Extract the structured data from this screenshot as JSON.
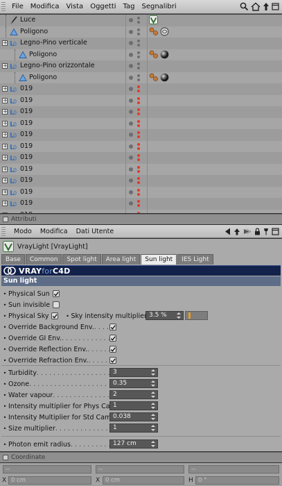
{
  "menu": {
    "items": [
      "File",
      "Modifica",
      "Vista",
      "Oggetti",
      "Tag",
      "Segnalibri"
    ]
  },
  "objects": [
    {
      "name": "Luce",
      "kind": "light",
      "indent": 0,
      "expandable": false,
      "tags": [
        "vray-light-tag"
      ],
      "dot_red": false
    },
    {
      "name": "Poligono",
      "kind": "polygon",
      "indent": 0,
      "expandable": false,
      "tags": [
        "material-tag",
        "texture-tag"
      ],
      "dot_red": false
    },
    {
      "name": "Legno-Pino verticale",
      "kind": "null",
      "indent": 0,
      "expandable": true,
      "tags": [],
      "dot_red": false
    },
    {
      "name": "Poligono",
      "kind": "polygon",
      "indent": 1,
      "expandable": false,
      "tags": [
        "material-tag",
        "sphere-material"
      ],
      "dot_red": false
    },
    {
      "name": "Legno-Pino orizzontale",
      "kind": "null",
      "indent": 0,
      "expandable": true,
      "tags": [],
      "dot_red": false
    },
    {
      "name": "Poligono",
      "kind": "polygon",
      "indent": 1,
      "expandable": false,
      "tags": [
        "material-tag",
        "sphere-material"
      ],
      "dot_red": false
    },
    {
      "name": "019",
      "kind": "null",
      "indent": 0,
      "expandable": true,
      "tags": [],
      "dot_red": true
    },
    {
      "name": "019",
      "kind": "null",
      "indent": 0,
      "expandable": true,
      "tags": [],
      "dot_red": true
    },
    {
      "name": "019",
      "kind": "null",
      "indent": 0,
      "expandable": true,
      "tags": [],
      "dot_red": true
    },
    {
      "name": "019",
      "kind": "null",
      "indent": 0,
      "expandable": true,
      "tags": [],
      "dot_red": true
    },
    {
      "name": "019",
      "kind": "null",
      "indent": 0,
      "expandable": true,
      "tags": [],
      "dot_red": true
    },
    {
      "name": "019",
      "kind": "null",
      "indent": 0,
      "expandable": true,
      "tags": [],
      "dot_red": true
    },
    {
      "name": "019",
      "kind": "null",
      "indent": 0,
      "expandable": true,
      "tags": [],
      "dot_red": true
    },
    {
      "name": "019",
      "kind": "null",
      "indent": 0,
      "expandable": true,
      "tags": [],
      "dot_red": true
    },
    {
      "name": "019",
      "kind": "null",
      "indent": 0,
      "expandable": true,
      "tags": [],
      "dot_red": true
    },
    {
      "name": "019",
      "kind": "null",
      "indent": 0,
      "expandable": true,
      "tags": [],
      "dot_red": true
    },
    {
      "name": "019",
      "kind": "null",
      "indent": 0,
      "expandable": true,
      "tags": [],
      "dot_red": true
    },
    {
      "name": "019",
      "kind": "null",
      "indent": 0,
      "expandable": true,
      "tags": [],
      "dot_red": true
    }
  ],
  "attributes": {
    "panel_title": "Attributi",
    "menu": [
      "Modo",
      "Modifica",
      "Dati Utente"
    ],
    "object_title": "VrayLight [VrayLight]",
    "tabs": [
      {
        "label": "Base",
        "active": false
      },
      {
        "label": "Common",
        "active": false
      },
      {
        "label": "Spot light",
        "active": false
      },
      {
        "label": "Area light",
        "active": false
      },
      {
        "label": "Sun light",
        "active": true
      },
      {
        "label": "IES Light",
        "active": false
      }
    ],
    "banner": {
      "v": "VRAY",
      "for": "for",
      "c4d": "C4D"
    },
    "section": "Sun light",
    "physical_sun": {
      "label": "Physical Sun",
      "checked": true
    },
    "sun_invisible": {
      "label": "Sun invisible",
      "checked": false
    },
    "physical_sky": {
      "label": "Physical Sky",
      "checked": true
    },
    "sky_intensity": {
      "label": "Sky intensity multiplier",
      "value": "3.5 %",
      "fraction": 0.035
    },
    "overrides": [
      {
        "label": "Override Background Env.",
        "leader": " . . . . . .",
        "checked": true
      },
      {
        "label": "Override GI Env.",
        "leader": " . . . . . . . . . . . . .",
        "checked": true
      },
      {
        "label": "Override Reflection Env.",
        "leader": " . . . . . . .",
        "checked": true
      },
      {
        "label": "Override Refraction Env.",
        "leader": " . . . . . . .",
        "checked": true
      }
    ],
    "params": [
      {
        "label": "Turbidity",
        "leader": " . . . . . . . . . . . . . . . . . . . . . . . .",
        "value": "3"
      },
      {
        "label": "Ozone",
        "leader": " . . . . . . . . . . . . . . . . . . . . . . . . . . .",
        "value": "0.35"
      },
      {
        "label": "Water vapour",
        "leader": " . . . . . . . . . . . . . . . . . . .",
        "value": "2"
      },
      {
        "label": "Intensity multiplier for Phys Cam",
        "leader": "",
        "value": "1"
      },
      {
        "label": "Intensity Multiplier for Std Cam",
        "leader": "",
        "value": "0.038"
      },
      {
        "label": "Size multiplier",
        "leader": " . . . . . . . . . . . . . . . . . .",
        "value": "1"
      }
    ],
    "photon_radius": {
      "label": "Photon emit radius",
      "leader": " . . . . . . . . . . . . . . .",
      "value": "127 cm"
    }
  },
  "coordinates": {
    "panel_title": "Coordinate",
    "fields": [
      {
        "axis": "X",
        "value": "0 cm",
        "axis_value": "X",
        "rot_value": "0 cm"
      },
      {
        "axis": "H",
        "value": "0 °"
      }
    ],
    "header_placeholders": [
      "--",
      "--",
      "--"
    ]
  },
  "colors": {
    "accent_orange": "#e69c2a",
    "banner_navy": "#13224a",
    "section_blue": "#5e6d87",
    "status_red": "#e33a2a"
  }
}
